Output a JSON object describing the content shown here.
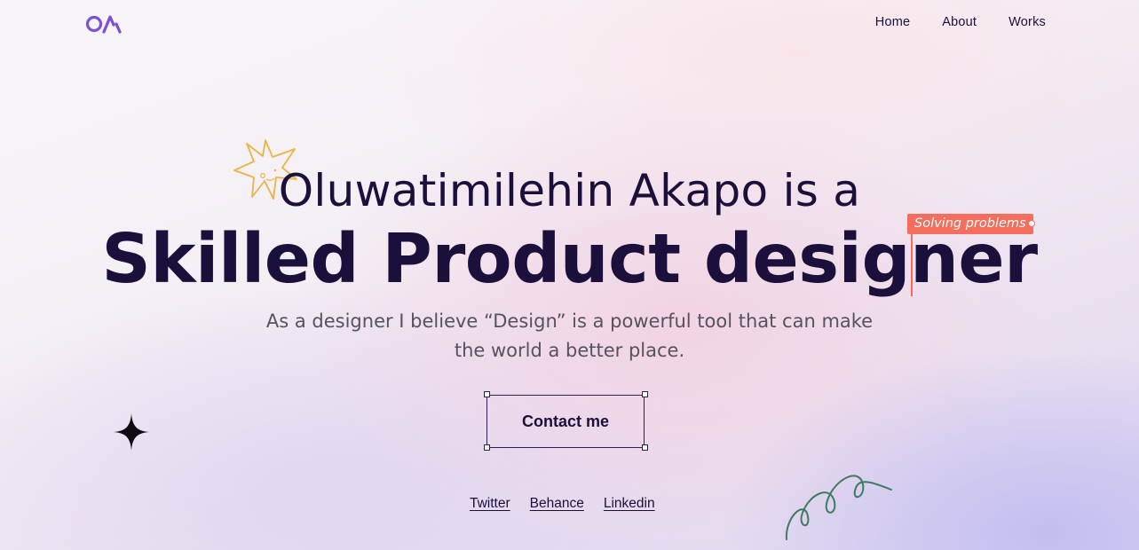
{
  "nav": {
    "logo_icon": "oa-monogram-logo",
    "items": [
      {
        "label": "Home"
      },
      {
        "label": "About"
      },
      {
        "label": "Works"
      }
    ]
  },
  "hero": {
    "line1": "Oluwatimilehin Akapo is a",
    "line2": "Skilled Product designer",
    "subtitle": "As a designer I believe “Design” is a powerful tool that can make the world a better place.",
    "cursor_tag": "Solving problems",
    "cta_label": "Contact me"
  },
  "socials": [
    {
      "label": "Twitter"
    },
    {
      "label": "Behance"
    },
    {
      "label": "Linkedin"
    }
  ],
  "decorations": {
    "burst_icon": "sun-burst-icon",
    "sparkle_icon": "four-point-star-icon",
    "squiggle_icon": "loop-squiggle-icon"
  },
  "colors": {
    "primary_text": "#1b0f3b",
    "logo": "#7b4fdc",
    "cursor_accent": "#f46d5d",
    "burst": "#e9b449",
    "squiggle": "#3f7a62"
  }
}
